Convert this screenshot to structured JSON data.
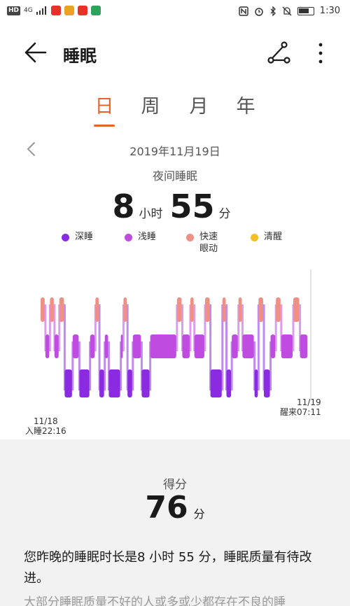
{
  "status_bar": {
    "left_chips": [
      "HD",
      "4G"
    ],
    "time": "1:30",
    "right_icons": [
      "nfc-icon",
      "alarm-icon",
      "bluetooth-icon",
      "mute-icon",
      "battery-icon"
    ]
  },
  "header": {
    "title": "睡眠",
    "back_icon": "arrow-left-icon",
    "share_icon": "share-icon",
    "more_icon": "more-vertical-icon"
  },
  "tabs": [
    {
      "label": "日",
      "active": true
    },
    {
      "label": "周",
      "active": false
    },
    {
      "label": "月",
      "active": false
    },
    {
      "label": "年",
      "active": false
    }
  ],
  "date_nav": {
    "date": "2019年11月19日",
    "prev_icon": "chevron-left-icon"
  },
  "summary": {
    "subtitle": "夜间睡眠",
    "hours": "8",
    "hours_unit": "小时",
    "minutes": "55",
    "minutes_unit": "分"
  },
  "legend": [
    {
      "label": "深睡",
      "color": "#8a2be2"
    },
    {
      "label": "浅睡",
      "color": "#c04be0"
    },
    {
      "label": "快速\n眼动",
      "color": "#f08f84"
    },
    {
      "label": "清醒",
      "color": "#f2c024"
    }
  ],
  "chart_data": {
    "type": "bar",
    "levels": [
      "deep",
      "light",
      "rem"
    ],
    "segments": [
      {
        "stage": "rem",
        "start": 0.0,
        "end": 0.018
      },
      {
        "stage": "light",
        "start": 0.018,
        "end": 0.035
      },
      {
        "stage": "rem",
        "start": 0.035,
        "end": 0.052
      },
      {
        "stage": "light",
        "start": 0.052,
        "end": 0.07
      },
      {
        "stage": "rem",
        "start": 0.07,
        "end": 0.09
      },
      {
        "stage": "deep",
        "start": 0.09,
        "end": 0.12
      },
      {
        "stage": "light",
        "start": 0.12,
        "end": 0.145
      },
      {
        "stage": "deep",
        "start": 0.145,
        "end": 0.185
      },
      {
        "stage": "light",
        "start": 0.185,
        "end": 0.205
      },
      {
        "stage": "rem",
        "start": 0.205,
        "end": 0.22
      },
      {
        "stage": "deep",
        "start": 0.22,
        "end": 0.24
      },
      {
        "stage": "light",
        "start": 0.24,
        "end": 0.255
      },
      {
        "stage": "deep",
        "start": 0.255,
        "end": 0.3
      },
      {
        "stage": "light",
        "start": 0.3,
        "end": 0.31
      },
      {
        "stage": "rem",
        "start": 0.31,
        "end": 0.325
      },
      {
        "stage": "deep",
        "start": 0.325,
        "end": 0.345
      },
      {
        "stage": "light",
        "start": 0.345,
        "end": 0.378
      },
      {
        "stage": "deep",
        "start": 0.378,
        "end": 0.41
      },
      {
        "stage": "light",
        "start": 0.41,
        "end": 0.51
      },
      {
        "stage": "rem",
        "start": 0.51,
        "end": 0.53
      },
      {
        "stage": "light",
        "start": 0.53,
        "end": 0.56
      },
      {
        "stage": "rem",
        "start": 0.56,
        "end": 0.575
      },
      {
        "stage": "light",
        "start": 0.575,
        "end": 0.615
      },
      {
        "stage": "rem",
        "start": 0.615,
        "end": 0.635
      },
      {
        "stage": "deep",
        "start": 0.635,
        "end": 0.68
      },
      {
        "stage": "rem",
        "start": 0.68,
        "end": 0.695
      },
      {
        "stage": "deep",
        "start": 0.695,
        "end": 0.715
      },
      {
        "stage": "light",
        "start": 0.715,
        "end": 0.74
      },
      {
        "stage": "rem",
        "start": 0.74,
        "end": 0.755
      },
      {
        "stage": "light",
        "start": 0.755,
        "end": 0.8
      },
      {
        "stage": "deep",
        "start": 0.8,
        "end": 0.815
      },
      {
        "stage": "rem",
        "start": 0.815,
        "end": 0.835
      },
      {
        "stage": "deep",
        "start": 0.835,
        "end": 0.86
      },
      {
        "stage": "light",
        "start": 0.86,
        "end": 0.88
      },
      {
        "stage": "rem",
        "start": 0.88,
        "end": 0.9
      },
      {
        "stage": "light",
        "start": 0.9,
        "end": 0.945
      },
      {
        "stage": "rem",
        "start": 0.945,
        "end": 0.97
      },
      {
        "stage": "light",
        "start": 0.97,
        "end": 1.0
      }
    ],
    "start_label": "11/18\n入睡22:16",
    "end_label": "11/19\n醒来07:11"
  },
  "score": {
    "title": "得分",
    "value": "76",
    "unit": "分"
  },
  "description": {
    "main": "您昨晚的睡眠时长是8 小时 55 分，睡眠质量有待改进。",
    "secondary": "大部分睡眠质量不好的人或多或少都存在不良的睡"
  }
}
